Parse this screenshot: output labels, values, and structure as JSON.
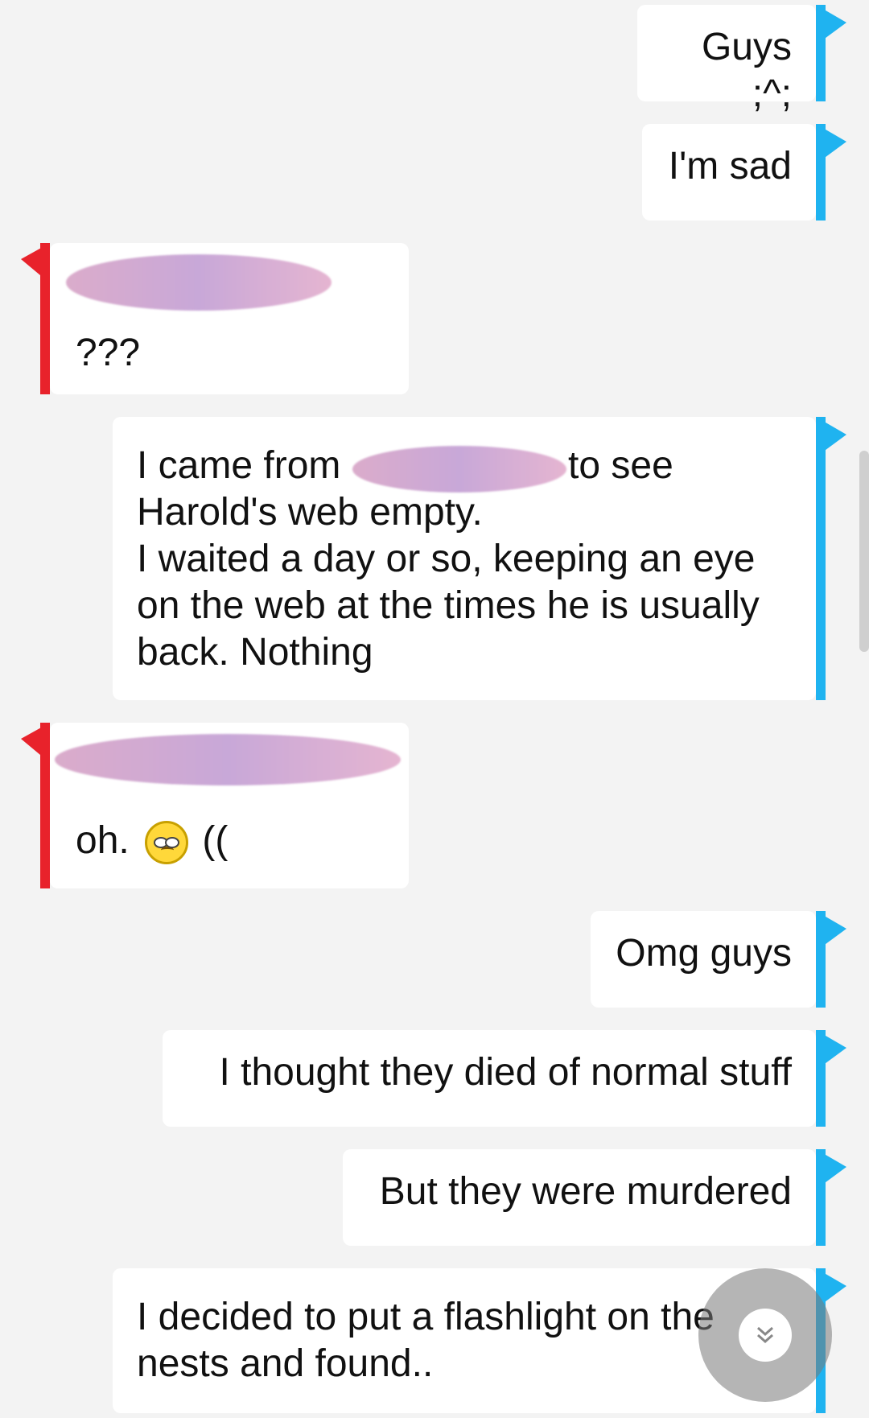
{
  "colors": {
    "outgoing_bar": "#1fb3f0",
    "incoming_bar": "#e8222b",
    "background": "#f3f3f3",
    "bubble": "#ffffff"
  },
  "messages": [
    {
      "direction": "out",
      "text": "Guys ;^;"
    },
    {
      "direction": "out",
      "text": "I'm sad"
    },
    {
      "direction": "in",
      "sender": "",
      "text": "???"
    },
    {
      "direction": "out",
      "lines": [
        "I came from",
        "to see",
        "Harold's web empty.",
        "I waited a day or so, keeping an eye",
        "on the web at the times he is usually",
        "back. Nothing"
      ]
    },
    {
      "direction": "in",
      "sender": "",
      "text": "oh.",
      "emoji": "sad-face-emoji",
      "suffix": "(("
    },
    {
      "direction": "out",
      "text": "Omg guys"
    },
    {
      "direction": "out",
      "text": "I thought they died of normal stuff"
    },
    {
      "direction": "out",
      "text": "But they were murdered"
    },
    {
      "direction": "out",
      "lines": [
        "I decided to put a flashlight on the",
        "nests and found.."
      ]
    }
  ],
  "scroll_button": {
    "icon": "double-chevron-down-icon",
    "glyph": "⌄"
  }
}
